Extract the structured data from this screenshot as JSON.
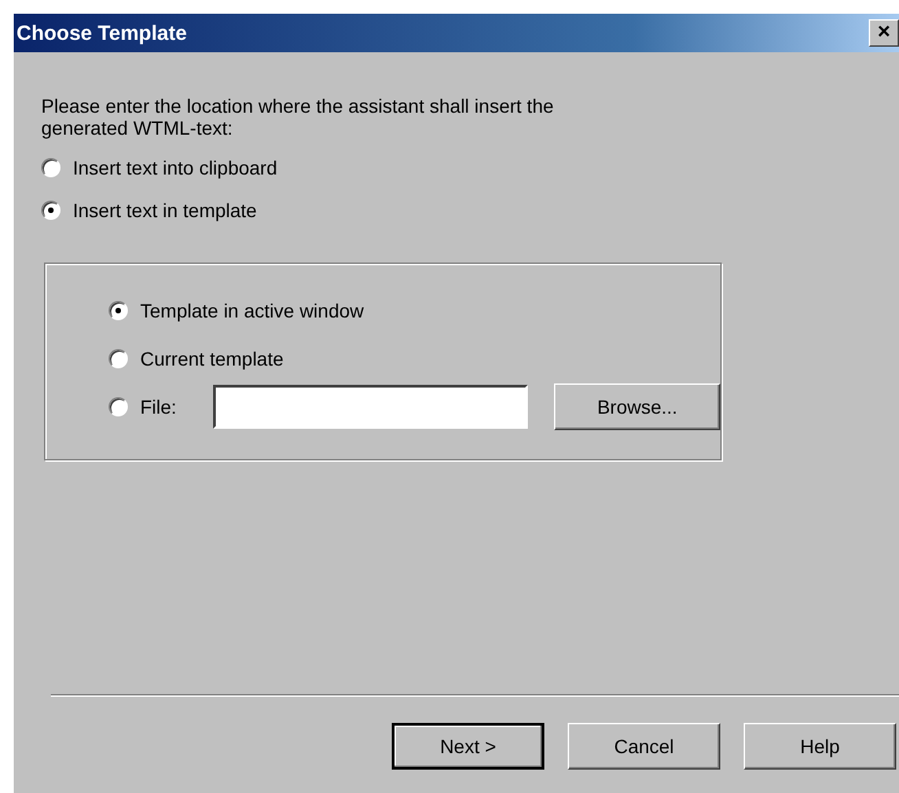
{
  "window": {
    "title": "Choose Template",
    "close_label": "×"
  },
  "prompt": "Please enter the location where the assistant shall insert the generated WTML-text:",
  "destinations": [
    {
      "label": "Insert text into clipboard",
      "selected": false
    },
    {
      "label": "Insert text in template",
      "selected": true
    }
  ],
  "template_options": [
    {
      "kind": "plain",
      "label": "Template in active window",
      "selected": true
    },
    {
      "kind": "plain",
      "label": "Current template",
      "selected": false
    },
    {
      "kind": "file",
      "label": "File:",
      "selected": false,
      "browse_label": "Browse..."
    }
  ],
  "buttons": [
    {
      "label": "Next >",
      "default": true
    },
    {
      "label": "Cancel",
      "default": false
    },
    {
      "label": "Help",
      "default": false
    }
  ]
}
